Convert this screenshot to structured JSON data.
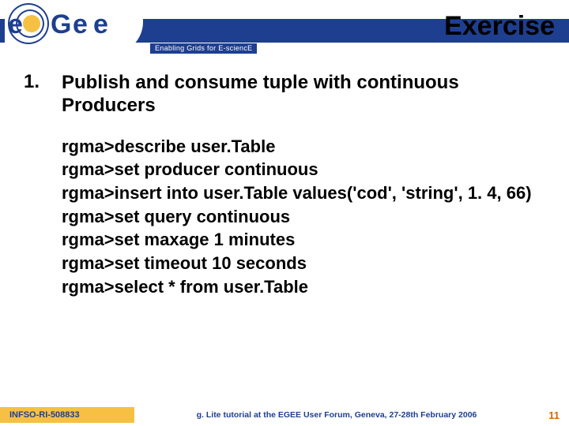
{
  "header": {
    "title": "Exercise",
    "tagline": "Enabling Grids for E-sciencE",
    "logo_text": "eGee"
  },
  "content": {
    "number": "1.",
    "heading": "Publish and consume tuple with continuous Producers",
    "commands": [
      "rgma>describe user.Table",
      "rgma>set producer continuous",
      "rgma>insert into user.Table values('cod', 'string', 1. 4, 66)",
      "rgma>set query continuous",
      "rgma>set maxage 1 minutes",
      "rgma>set timeout 10 seconds",
      "rgma>select * from user.Table"
    ]
  },
  "footer": {
    "left": "INFSO-RI-508833",
    "mid": "g. Lite tutorial at the EGEE User Forum, Geneva, 27-28th February 2006",
    "page": "11"
  }
}
